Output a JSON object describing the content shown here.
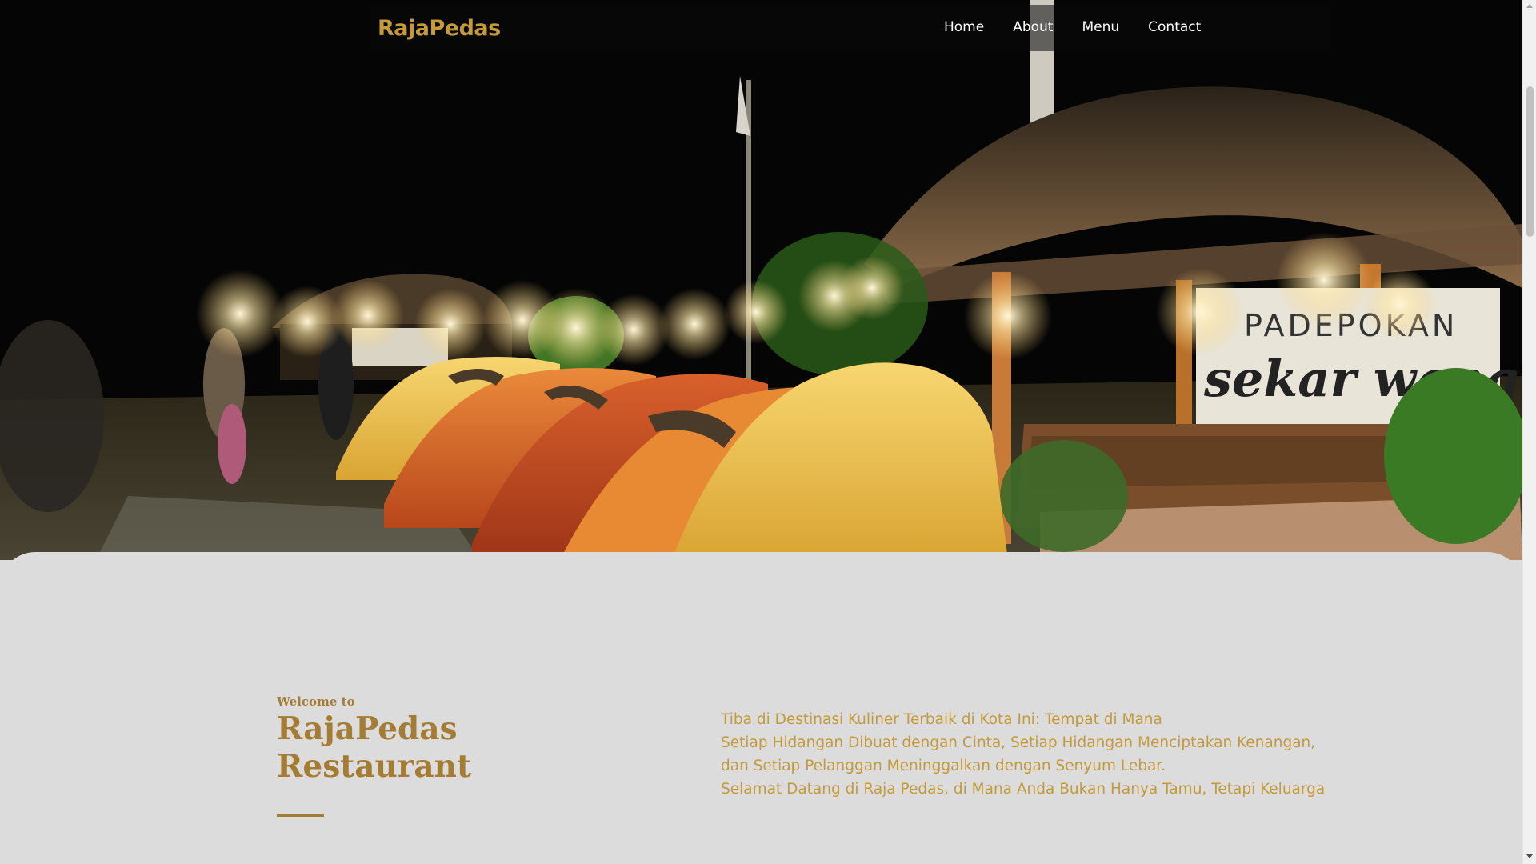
{
  "brand": {
    "name": "RajaPedas",
    "color": "#c49a3a"
  },
  "nav": {
    "items": [
      {
        "label": "Home"
      },
      {
        "label": "About"
      },
      {
        "label": "Menu"
      },
      {
        "label": "Contact"
      }
    ]
  },
  "hero": {
    "sign_line1": "PADEPOKAN",
    "sign_line2": "sekar wangi"
  },
  "intro": {
    "welcome": "Welcome to",
    "title_line1": "RajaPedas",
    "title_line2": "Restaurant",
    "accent_color": "#a57c33",
    "description": [
      "Tiba di Destinasi Kuliner Terbaik di Kota Ini: Tempat di Mana",
      "Setiap Hidangan Dibuat dengan Cinta, Setiap Hidangan Menciptakan Kenangan,",
      "dan Setiap Pelanggan Meninggalkan dengan Senyum Lebar.",
      "Selamat Datang di Raja Pedas, di Mana Anda Bukan Hanya Tamu, Tetapi Keluarga"
    ]
  }
}
